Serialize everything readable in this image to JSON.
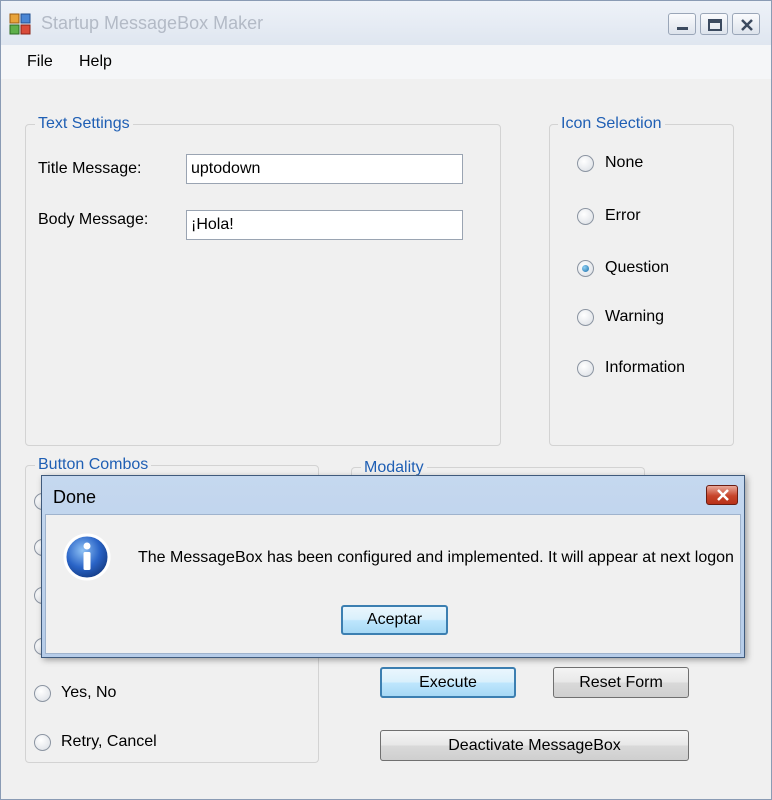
{
  "window": {
    "title": "Startup MessageBox Maker",
    "menu": [
      "File",
      "Help"
    ]
  },
  "text_settings": {
    "legend": "Text Settings",
    "title_label": "Title Message:",
    "title_value": "uptodown",
    "body_label": "Body Message:",
    "body_value": "¡Hola!"
  },
  "icon_selection": {
    "legend": "Icon Selection",
    "options": [
      "None",
      "Error",
      "Question",
      "Warning",
      "Information"
    ],
    "selected": "Question"
  },
  "button_combos": {
    "legend": "Button Combos",
    "visible_options": [
      "Yes, No",
      "Retry, Cancel"
    ]
  },
  "modality": {
    "legend": "Modality"
  },
  "actions": {
    "execute": "Execute",
    "reset": "Reset Form",
    "deactivate": "Deactivate MessageBox"
  },
  "dialog": {
    "title": "Done",
    "message": "The MessageBox has been configured and implemented. It will appear at next logon",
    "ok_label": "Aceptar",
    "icon": "information-icon"
  },
  "icons": [
    "app-icon",
    "minimize-icon",
    "maximize-icon",
    "close-icon",
    "information-icon"
  ],
  "colors": {
    "group_label": "#1f5fb4",
    "dialog_close": "#c7442a",
    "focus_border": "#3c7fb1"
  }
}
